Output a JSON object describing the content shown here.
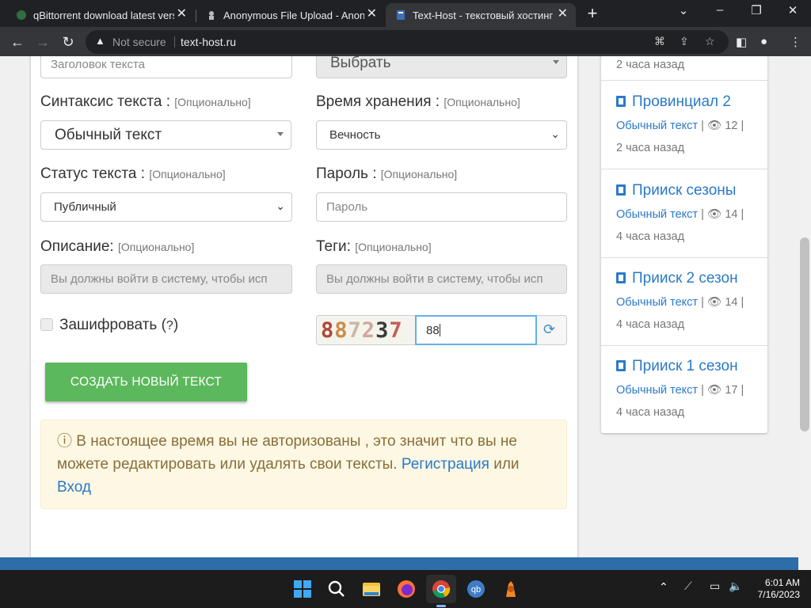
{
  "browser": {
    "tabs": [
      {
        "title": "qBittorrent download latest versi",
        "close": "✕"
      },
      {
        "title": "Anonymous File Upload - AnonFi",
        "close": "✕"
      },
      {
        "title": "Text-Host - текстовый хостинг",
        "close": "✕"
      }
    ],
    "new_tab": "+",
    "not_secure": "Not secure",
    "url": "text-host.ru"
  },
  "form": {
    "title_placeholder": "Заголовок текста",
    "category_value": "Выбрать",
    "syntax_label": "Синтаксис текста :",
    "optional": "[Опционально]",
    "syntax_value": "Обычный текст",
    "expiry_label": "Время хранения :",
    "expiry_value": "Вечность",
    "status_label": "Статус текста :",
    "status_value": "Публичный",
    "password_label": "Пароль :",
    "password_placeholder": "Пароль",
    "description_label": "Описание:",
    "description_placeholder": "Вы должны войти в систему, чтобы исп",
    "tags_label": "Теги:",
    "tags_placeholder": "Вы должны войти в систему, чтобы исп",
    "encrypt_label": "Зашифровать (",
    "encrypt_help": "?",
    "encrypt_close": ")",
    "captcha_text": "887237",
    "captcha_input": "88",
    "submit": "СОЗДАТЬ НОВЫЙ ТЕКСТ"
  },
  "alert": {
    "text": "В настоящее время вы не авторизованы , это значит что вы не можете редактировать или удалять свои тексты.",
    "register": "Регистрация",
    "or": "или",
    "login": "Вход"
  },
  "sidebar": {
    "top_time": "2 часа назад",
    "items": [
      {
        "title": "Провинциал 2",
        "syntax": "Обычный текст",
        "views": "12",
        "time": "2 часа назад"
      },
      {
        "title": "Прииск сезоны",
        "syntax": "Обычный текст",
        "views": "14",
        "time": "4 часа назад"
      },
      {
        "title": "Прииск 2 сезон",
        "syntax": "Обычный текст",
        "views": "14",
        "time": "4 часа назад"
      },
      {
        "title": "Прииск 1 сезон",
        "syntax": "Обычный текст",
        "views": "17",
        "time": "4 часа назад"
      }
    ]
  },
  "taskbar": {
    "time": "6:01 AM",
    "date": "7/16/2023"
  },
  "colors": {
    "accent": "#2a7ac9",
    "button": "#5cb85c",
    "alert_bg": "#fcf8e3",
    "alert_text": "#8a6d3b"
  }
}
